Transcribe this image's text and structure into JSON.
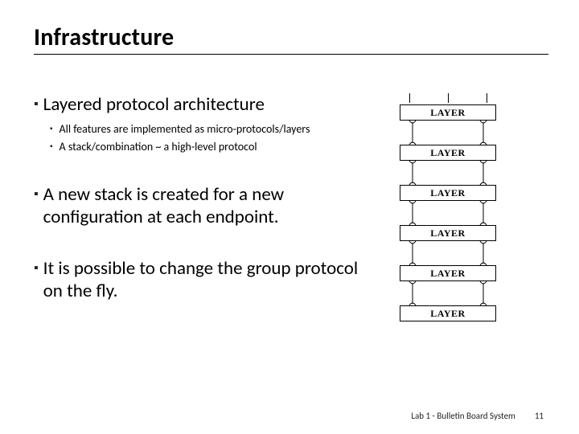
{
  "title": "Infrastructure",
  "bullets": [
    {
      "text": "Layered protocol architecture",
      "children": [
        "All features are implemented as micro-protocols/layers",
        "A stack/combination ~ a high-level protocol"
      ]
    },
    {
      "text": "A new stack is created for a new configuration at each endpoint.",
      "children": []
    },
    {
      "text": "It is possible to change the group protocol on the fly.",
      "children": []
    }
  ],
  "diagram": {
    "layer_label": "LAYER",
    "layer_count": 6
  },
  "footer": {
    "label": "Lab 1 - Bulletin Board System",
    "page": "11"
  }
}
